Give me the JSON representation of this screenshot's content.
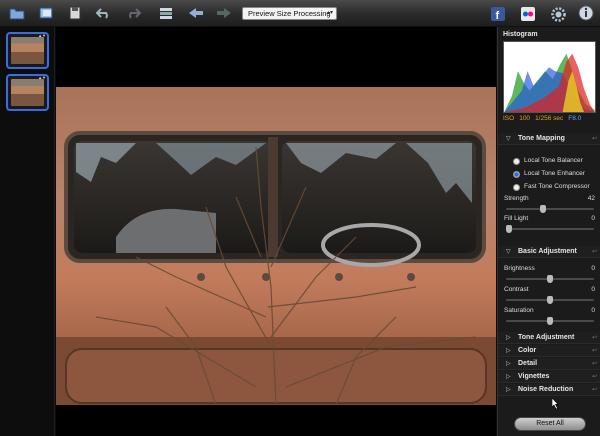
{
  "toolbar": {
    "preview_select_value": "Preview Size Processing",
    "buttons": [
      "open-folder-icon",
      "browse-icon",
      "save-icon",
      "undo-icon",
      "redo-icon",
      "compare-icon",
      "back-arrow-icon",
      "forward-arrow-icon"
    ],
    "right_buttons": [
      "facebook-icon",
      "flickr-icon",
      "settings-gear-icon",
      "info-icon"
    ]
  },
  "histogram": {
    "title": "Histogram",
    "exif": {
      "iso_label": "ISO",
      "iso_value": "100",
      "shutter": "1/256 sec",
      "aperture": "F8.0"
    }
  },
  "tone_mapping": {
    "title": "Tone Mapping",
    "options": [
      "Local Tone Balancer",
      "Local Tone Enhancer",
      "Fast Tone Compressor"
    ],
    "selected_index": 1,
    "strength_label": "Strength",
    "strength_value": "42",
    "strength_fraction": 0.42,
    "fill_light_label": "Fill Light",
    "fill_light_value": "0",
    "fill_light_fraction": 0.0
  },
  "basic_adjustment": {
    "title": "Basic Adjustment",
    "brightness_label": "Brightness",
    "brightness_value": "0",
    "brightness_fraction": 0.5,
    "contrast_label": "Contrast",
    "contrast_value": "0",
    "contrast_fraction": 0.5,
    "saturation_label": "Saturation",
    "saturation_value": "0",
    "saturation_fraction": 0.5
  },
  "collapsed_sections": [
    "Tone Adjustment",
    "Color",
    "Detail",
    "Vignettes",
    "Noise Reduction"
  ],
  "reset_label": "Reset All",
  "colors": {
    "accent": "#3b6de0",
    "exif_orange": "#e8a020",
    "exif_blue": "#6ea0ff"
  }
}
